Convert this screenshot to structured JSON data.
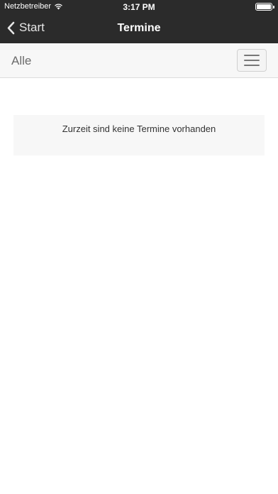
{
  "status_bar": {
    "carrier": "Netzbetreiber",
    "time": "3:17 PM",
    "icons": [
      "wifi-icon",
      "battery-icon"
    ]
  },
  "nav": {
    "back_label": "Start",
    "title": "Termine"
  },
  "filter": {
    "label": "Alle",
    "menu_icon": "hamburger-menu-icon"
  },
  "content": {
    "empty_message": "Zurzeit sind keine Termine vorhanden"
  },
  "colors": {
    "nav_background": "#2b2b2b",
    "filter_background": "#f7f7f7",
    "panel_background": "#f7f7f7"
  }
}
